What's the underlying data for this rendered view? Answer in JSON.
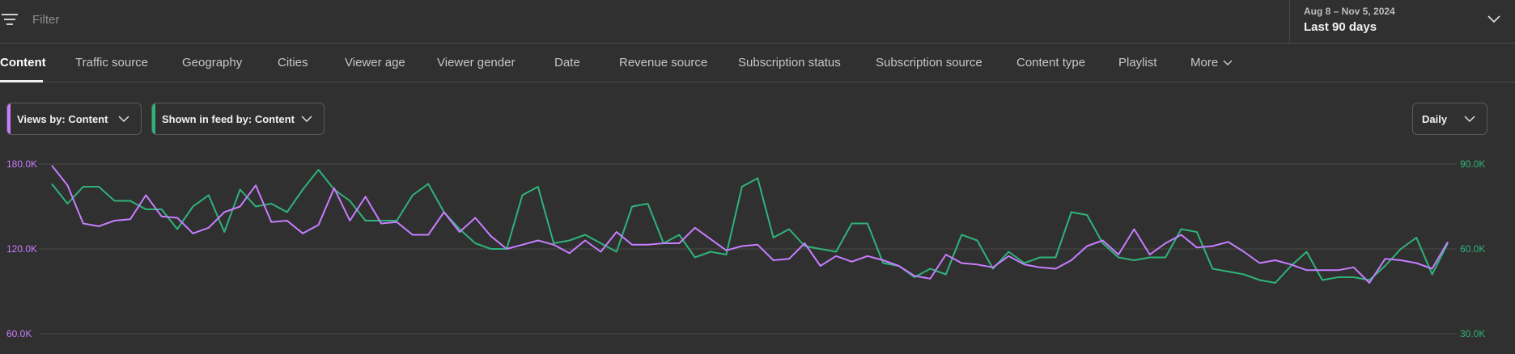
{
  "filter": {
    "placeholder": "Filter",
    "icon": "filter-list-icon"
  },
  "date_range": {
    "range": "Aug 8 – Nov 5, 2024",
    "label": "Last 90 days"
  },
  "tabs": [
    {
      "label": "Content",
      "active": true
    },
    {
      "label": "Traffic source"
    },
    {
      "label": "Geography"
    },
    {
      "label": "Cities"
    },
    {
      "label": "Viewer age"
    },
    {
      "label": "Viewer gender"
    },
    {
      "label": "Date"
    },
    {
      "label": "Revenue source"
    },
    {
      "label": "Subscription status"
    },
    {
      "label": "Subscription source"
    },
    {
      "label": "Content type"
    },
    {
      "label": "Playlist"
    },
    {
      "label": "More"
    }
  ],
  "controls": {
    "views_selector": "Views by: Content",
    "feed_selector": "Shown in feed by: Content",
    "interval": "Daily"
  },
  "colors": {
    "views": "#c77dff",
    "feed": "#2fb37a",
    "grid": "#4a4a4a",
    "background": "#303030"
  },
  "chart_data": {
    "type": "line",
    "grid": true,
    "y_left": {
      "ticks": [
        "180.0K",
        "120.0K",
        "60.0K"
      ],
      "range": [
        60000,
        180000
      ]
    },
    "y_right": {
      "ticks": [
        "90.0K",
        "60.0K",
        "30.0K"
      ],
      "range": [
        30000,
        90000
      ]
    },
    "series": [
      {
        "axis": "left",
        "values": [
          179,
          165,
          138,
          136,
          140,
          141,
          158,
          143,
          142,
          131,
          135,
          146,
          150,
          165,
          139,
          140,
          131,
          137,
          163,
          140,
          157,
          138,
          139,
          130,
          130,
          146,
          132,
          142,
          129,
          120,
          123,
          126,
          123,
          117,
          126,
          118,
          132,
          123,
          123,
          124,
          124,
          135,
          127,
          119,
          122,
          123,
          112,
          113,
          124,
          108,
          115,
          111,
          115,
          112,
          108,
          101,
          99,
          116,
          110,
          109,
          107,
          115,
          109,
          107,
          106,
          112,
          122,
          126,
          116,
          134,
          116,
          124,
          130,
          121,
          122,
          125,
          118,
          110,
          112,
          109,
          105,
          105,
          105,
          107,
          96,
          113,
          112,
          110,
          106,
          125
        ]
      },
      {
        "axis": "right",
        "values": [
          83,
          76,
          82,
          82,
          77,
          77,
          74,
          74,
          67,
          75,
          79,
          66,
          81,
          75,
          76,
          73,
          81,
          88,
          81,
          77,
          70,
          70,
          70,
          79,
          83,
          73,
          67,
          62,
          60,
          60,
          79,
          82,
          62,
          63,
          65,
          62,
          59,
          75,
          76,
          62,
          65,
          57,
          59,
          58,
          82,
          85,
          64,
          67,
          61,
          60,
          59,
          69,
          69,
          55,
          54,
          50,
          53,
          51,
          65,
          63,
          53,
          59,
          55,
          57,
          57,
          73,
          72,
          62,
          57,
          56,
          57,
          57,
          67,
          66,
          53,
          52,
          51,
          49,
          48,
          54,
          59,
          49,
          50,
          50,
          49,
          54,
          60,
          64,
          51,
          62
        ]
      }
    ]
  }
}
